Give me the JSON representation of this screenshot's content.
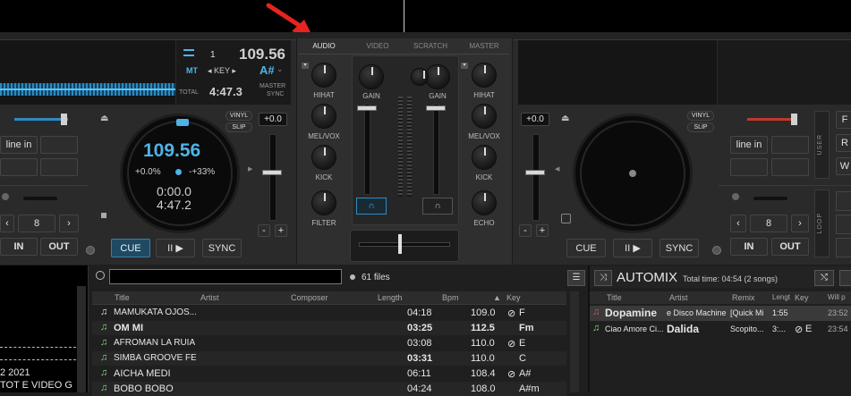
{
  "mixer": {
    "tabs": [
      "AUDIO",
      "VIDEO",
      "SCRATCH",
      "MASTER"
    ],
    "left_knobs": [
      "HIHAT",
      "MEL/VOX",
      "KICK",
      "FILTER"
    ],
    "right_knobs": [
      "HIHAT",
      "MEL/VOX",
      "KICK",
      "ECHO"
    ],
    "gain_label": "GAIN"
  },
  "deck_left": {
    "deck_number": "1",
    "bpm": "109.56",
    "mt_label": "MT",
    "key_label": "◂ KEY ▸",
    "key_value": "A#",
    "total_label": "TOTAL",
    "total_time": "4:47.3",
    "master_label": "MASTER",
    "sync_label": "SYNC",
    "platter_bpm": "109.56",
    "pitch_pct": "+0.0%",
    "pitch_range": "-+33%",
    "elapsed": "0:00.0",
    "remaining": "4:47.2",
    "vinyl_label": "VINYL",
    "slip_label": "SLIP",
    "pitch_box": "+0.0",
    "line_in_label": "line in",
    "loop_value": "8",
    "in_label": "IN",
    "out_label": "OUT",
    "cue_label": "CUE",
    "play_label": "II ▶",
    "sync_button": "SYNC",
    "minus": "-",
    "plus": "+"
  },
  "deck_right": {
    "pitch_box": "+0.0",
    "vinyl_label": "VINYL",
    "slip_label": "SLIP",
    "line_in_label": "line in",
    "loop_value": "8",
    "in_label": "IN",
    "out_label": "OUT",
    "cue_label": "CUE",
    "play_label": "II ▶",
    "sync_button": "SYNC",
    "user_label": "USER",
    "loop_label": "LOOP",
    "minus": "-",
    "plus": "+",
    "side_buttons": [
      "F",
      "R",
      "W"
    ]
  },
  "browser": {
    "search_placeholder": "",
    "file_count": "61 files",
    "columns": [
      "Title",
      "Artist",
      "Composer",
      "Length",
      "Bpm",
      "Key"
    ],
    "rows": [
      {
        "title": "MAMUKATA OJOS...",
        "length": "04:18",
        "bpm": "109.0",
        "key": "F",
        "key_icon": "⊘",
        "note": "♫"
      },
      {
        "title": "OM MI",
        "length": "03:25",
        "bpm": "112.5",
        "key": "Fm",
        "key_icon": "",
        "note": "♫"
      },
      {
        "title": "AFROMAN LA RUIA",
        "length": "03:08",
        "bpm": "110.0",
        "key": "E",
        "key_icon": "⊘",
        "note": "♫"
      },
      {
        "title": "SIMBA GROOVE FE...",
        "length": "03:31",
        "bpm": "110.0",
        "key": "C",
        "key_icon": "",
        "note": "♫"
      },
      {
        "title": "AICHA MEDI",
        "length": "06:11",
        "bpm": "108.4",
        "key": "A#",
        "key_icon": "⊘",
        "note": "♫"
      },
      {
        "title": "BOBO BOBO",
        "length": "04:24",
        "bpm": "108.0",
        "key": "A#m",
        "key_icon": "",
        "note": "♫"
      }
    ]
  },
  "left_panel": {
    "line1": "2 2021",
    "line2": "TOT  E VIDEO  G"
  },
  "automix": {
    "title": "AUTOMIX",
    "total": "Total time: 04:54 (2 songs)",
    "columns": [
      "Title",
      "Artist",
      "Remix",
      "Lengt",
      "Key",
      "Will p"
    ],
    "rows": [
      {
        "title": "Dopamine",
        "artist": "e Disco Machine f",
        "remix": "[Quick Mi",
        "length": "1:55",
        "key": "",
        "will": "23:52"
      },
      {
        "title": "Ciao Amore Ci...",
        "artist": "Dalida",
        "remix": "Scopito...",
        "length": "3:...",
        "key": "E",
        "will": "23:54"
      }
    ]
  },
  "colors": {
    "accent_blue": "#4fb3e8",
    "arrow_red": "#e8231f",
    "note_green": "#7fdc7f"
  }
}
